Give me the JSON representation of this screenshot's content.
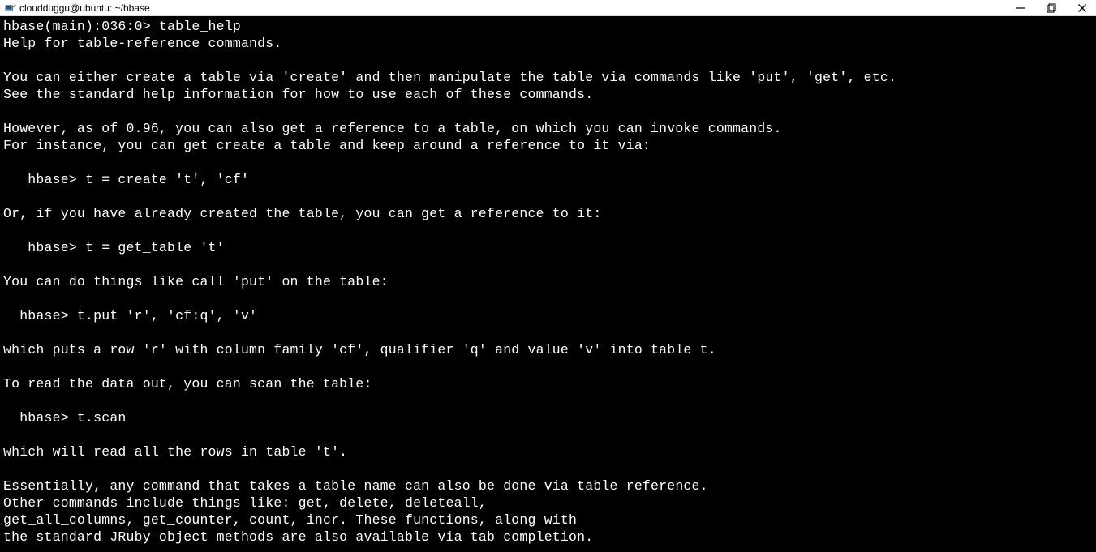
{
  "titlebar": {
    "title": "cloudduggu@ubuntu: ~/hbase"
  },
  "terminal": {
    "prompt": "hbase(main):036:0> ",
    "command": "table_help",
    "lines": [
      "Help for table-reference commands.",
      "",
      "You can either create a table via 'create' and then manipulate the table via commands like 'put', 'get', etc.",
      "See the standard help information for how to use each of these commands.",
      "",
      "However, as of 0.96, you can also get a reference to a table, on which you can invoke commands.",
      "For instance, you can get create a table and keep around a reference to it via:",
      "",
      "   hbase> t = create 't', 'cf'",
      "",
      "Or, if you have already created the table, you can get a reference to it:",
      "",
      "   hbase> t = get_table 't'",
      "",
      "You can do things like call 'put' on the table:",
      "",
      "  hbase> t.put 'r', 'cf:q', 'v'",
      "",
      "which puts a row 'r' with column family 'cf', qualifier 'q' and value 'v' into table t.",
      "",
      "To read the data out, you can scan the table:",
      "",
      "  hbase> t.scan",
      "",
      "which will read all the rows in table 't'.",
      "",
      "Essentially, any command that takes a table name can also be done via table reference.",
      "Other commands include things like: get, delete, deleteall,",
      "get_all_columns, get_counter, count, incr. These functions, along with",
      "the standard JRuby object methods are also available via tab completion."
    ]
  }
}
